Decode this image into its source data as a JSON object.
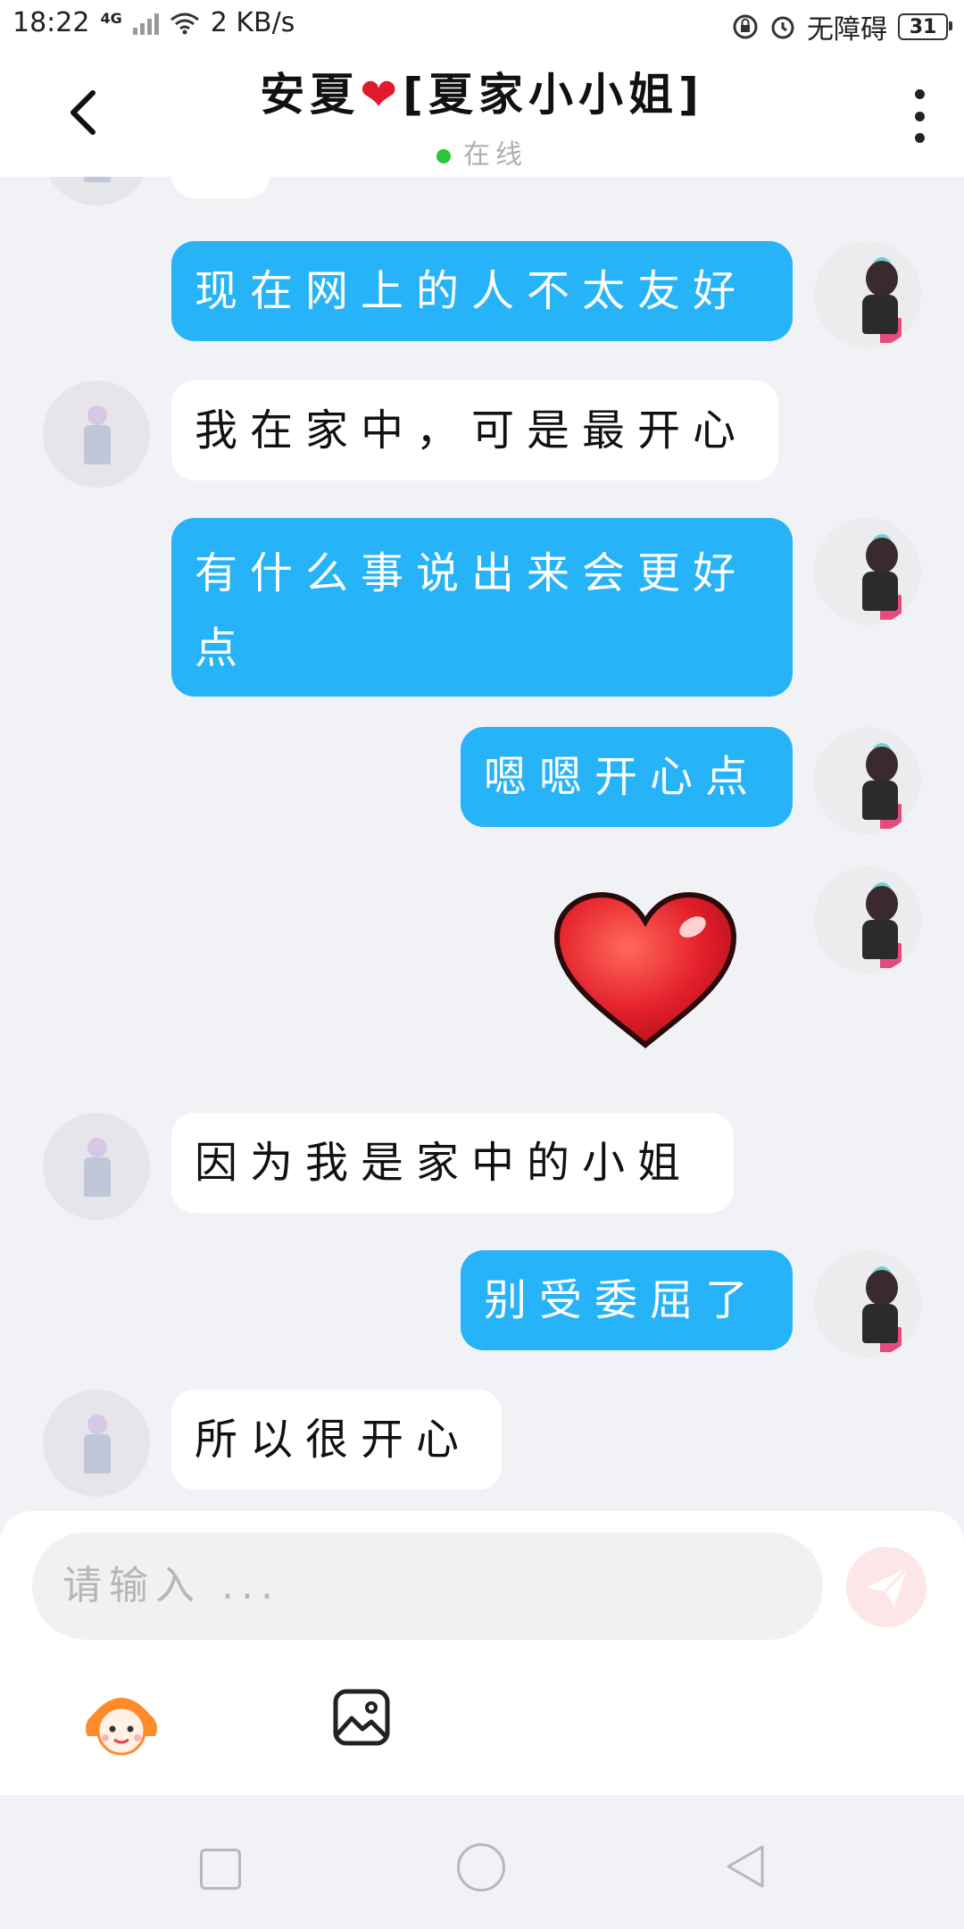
{
  "status_bar": {
    "time": "18:22",
    "network": "4G",
    "speed": "2 KB/s",
    "accessibility": "无障碍",
    "battery": "31",
    "icons": [
      "signal-icon",
      "wifi-icon",
      "lock-rotation-icon",
      "alarm-icon",
      "battery-icon"
    ]
  },
  "header": {
    "title_prefix": "安夏",
    "title_heart": "❤",
    "title_suffix": "[夏家小小姐]",
    "status": "在线",
    "status_color": "#2bc53a"
  },
  "messages": [
    {
      "side": "out",
      "text": "现在网上的人不太友好"
    },
    {
      "side": "in",
      "text": "我在家中，可是最开心"
    },
    {
      "side": "out",
      "text": "有什么事说出来会更好点"
    },
    {
      "side": "out",
      "text": "嗯嗯开心点"
    },
    {
      "side": "out",
      "type": "sticker",
      "sticker": "heart-sticker"
    },
    {
      "side": "in",
      "text": "因为我是家中的小姐"
    },
    {
      "side": "out",
      "text": "别受委屈了"
    },
    {
      "side": "in",
      "text": "所以很开心"
    }
  ],
  "composer": {
    "placeholder": "请输入 ...",
    "send_icon": "send-icon",
    "emoji_icon": "emoji-icon",
    "image_icon": "image-icon"
  },
  "colors": {
    "outgoing_bubble": "#27b3f7",
    "incoming_bubble": "#ffffff",
    "background": "#f1f2f6"
  }
}
